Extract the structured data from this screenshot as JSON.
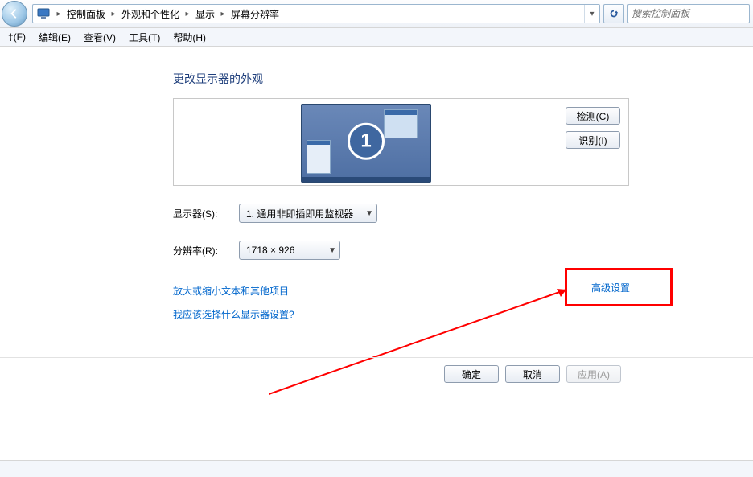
{
  "breadcrumb": {
    "items": [
      "控制面板",
      "外观和个性化",
      "显示",
      "屏幕分辨率"
    ]
  },
  "search": {
    "placeholder": "搜索控制面板"
  },
  "menu": {
    "file": "‡(F)",
    "edit": "编辑(E)",
    "view": "查看(V)",
    "tools": "工具(T)",
    "help": "帮助(H)"
  },
  "page": {
    "title": "更改显示器的外观",
    "monitor_badge": "1",
    "detect": "检测(C)",
    "identify": "识别(I)",
    "display_label": "显示器(S):",
    "display_value": "1. 通用非即插即用监视器",
    "resolution_label": "分辨率(R):",
    "resolution_value": "1718 × 926",
    "advanced": "高级设置",
    "link_textsize": "放大或缩小文本和其他项目",
    "link_help": "我应该选择什么显示器设置?",
    "ok": "确定",
    "cancel": "取消",
    "apply": "应用(A)"
  }
}
